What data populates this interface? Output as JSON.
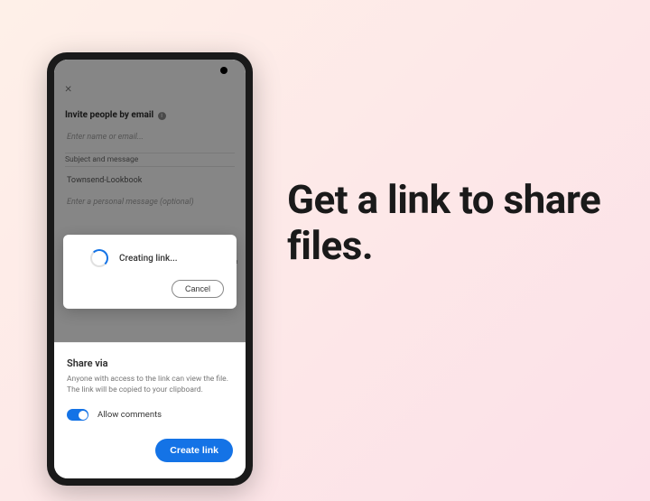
{
  "marketing": {
    "headline": "Get a link to share files."
  },
  "invite": {
    "close": "×",
    "title": "Invite people by email",
    "name_placeholder": "Enter name or email...",
    "subject_label": "Subject and message",
    "subject_value": "Townsend-Lookbook",
    "message_placeholder": "Enter a personal message (optional)"
  },
  "modal": {
    "status": "Creating link...",
    "cancel": "Cancel"
  },
  "sheet": {
    "title": "Share via",
    "description": "Anyone with access to the link can view the file. The link will be copied to your clipboard.",
    "allow_comments": "Allow comments",
    "create_button": "Create link"
  }
}
